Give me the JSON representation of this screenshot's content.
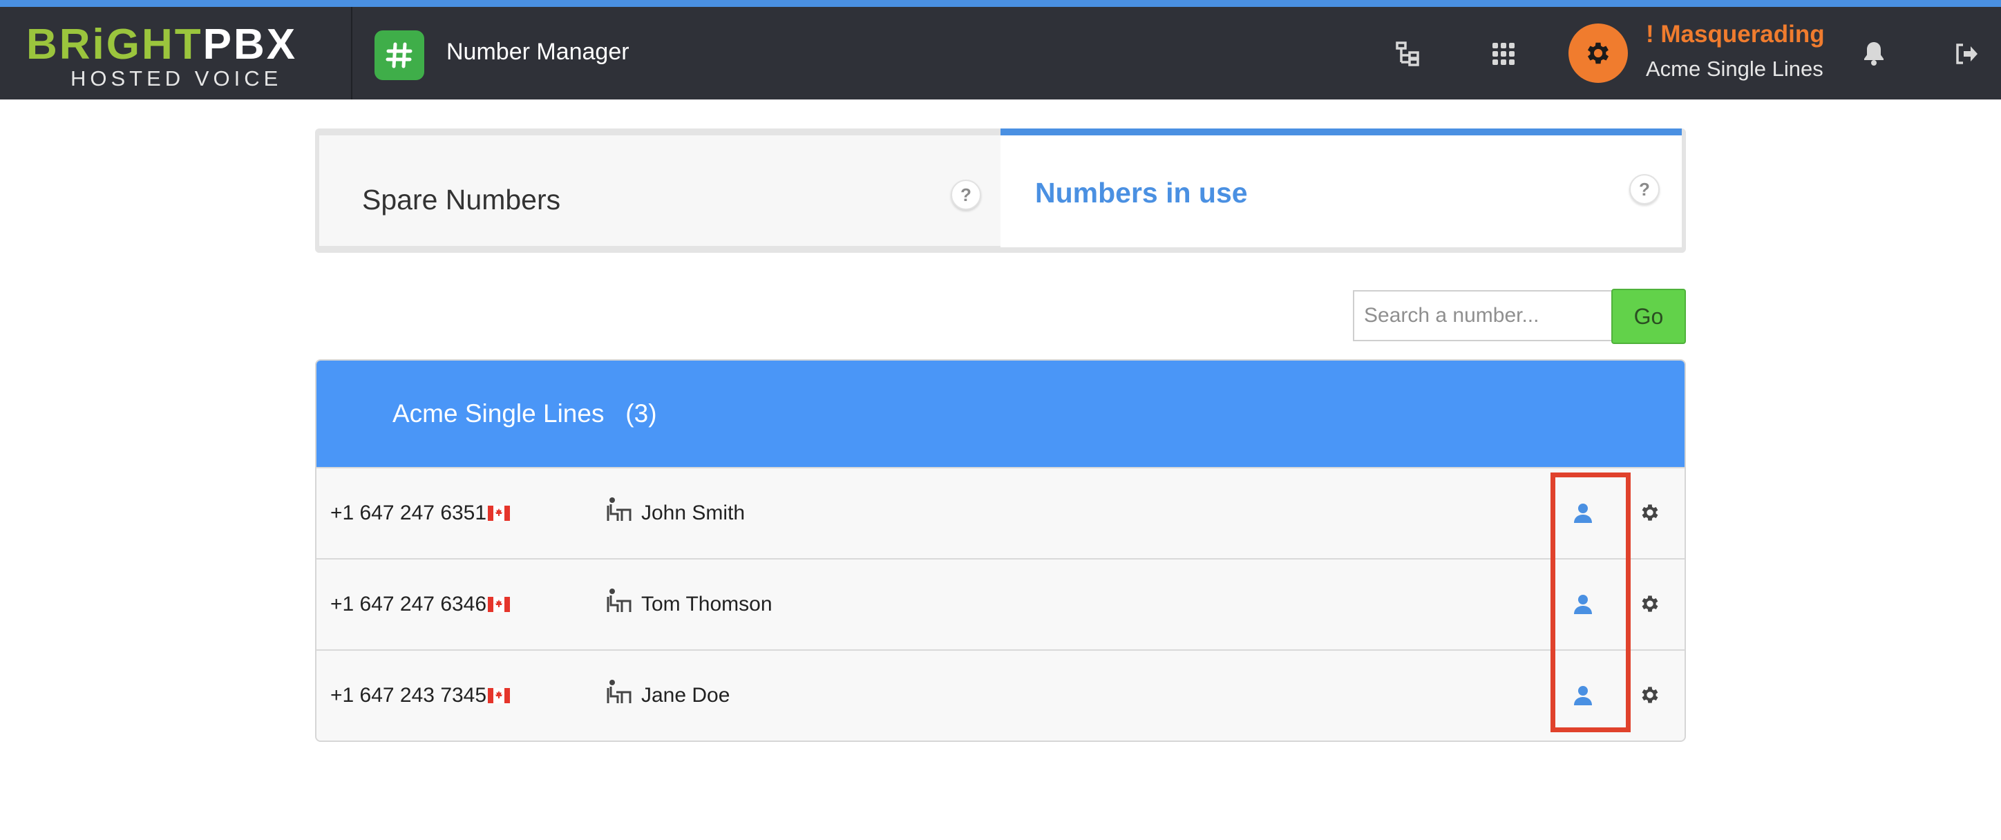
{
  "header": {
    "logo_part1": "BRiGHT",
    "logo_part2": "PBX",
    "logo_sub": "HOSTED VOICE",
    "app_title": "Number Manager",
    "masquerading_label": "! Masquerading",
    "account_name": "Acme Single Lines",
    "icons": [
      "hierarchy-icon",
      "apps-grid-icon",
      "gear-icon",
      "bell-icon",
      "logout-icon"
    ]
  },
  "tabs": [
    {
      "label": "Spare Numbers",
      "active": false
    },
    {
      "label": "Numbers in use",
      "active": true
    }
  ],
  "help_glyph": "?",
  "search": {
    "placeholder": "Search a number...",
    "value": "",
    "go_label": "Go"
  },
  "group": {
    "name": "Acme Single Lines",
    "count": "(3)",
    "rows": [
      {
        "number": "+1 647 247 6351",
        "country": "Canada",
        "user": "John Smith"
      },
      {
        "number": "+1 647 247 6346",
        "country": "Canada",
        "user": "Tom Thomson"
      },
      {
        "number": "+1 647 243 7345",
        "country": "Canada",
        "user": "Jane Doe"
      }
    ]
  },
  "colors": {
    "topbar": "#2f3138",
    "accent": "#4a90e2",
    "group_header": "#4a96f7",
    "masquerade": "#f07c2e",
    "go_button": "#62d24a",
    "highlight_box": "#e0422c",
    "logo_green": "#9bc53d"
  }
}
